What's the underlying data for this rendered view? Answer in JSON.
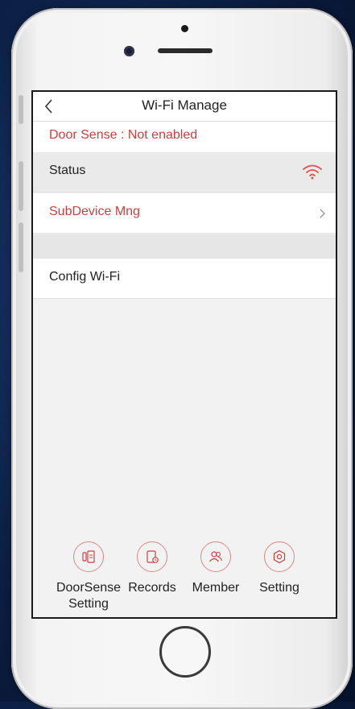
{
  "header": {
    "title": "Wi-Fi Manage"
  },
  "door_sense": {
    "text": "Door Sense : Not enabled"
  },
  "rows": {
    "status": "Status",
    "subdevice": "SubDevice Mng",
    "config_wifi": "Config Wi-Fi"
  },
  "tabs": [
    {
      "label": "DoorSense Setting",
      "icon": "doorsense-icon"
    },
    {
      "label": "Records",
      "icon": "records-icon"
    },
    {
      "label": "Member",
      "icon": "member-icon"
    },
    {
      "label": "Setting",
      "icon": "setting-icon"
    }
  ],
  "colors": {
    "accent": "#c9413f",
    "icon_ring": "#d98a88"
  }
}
